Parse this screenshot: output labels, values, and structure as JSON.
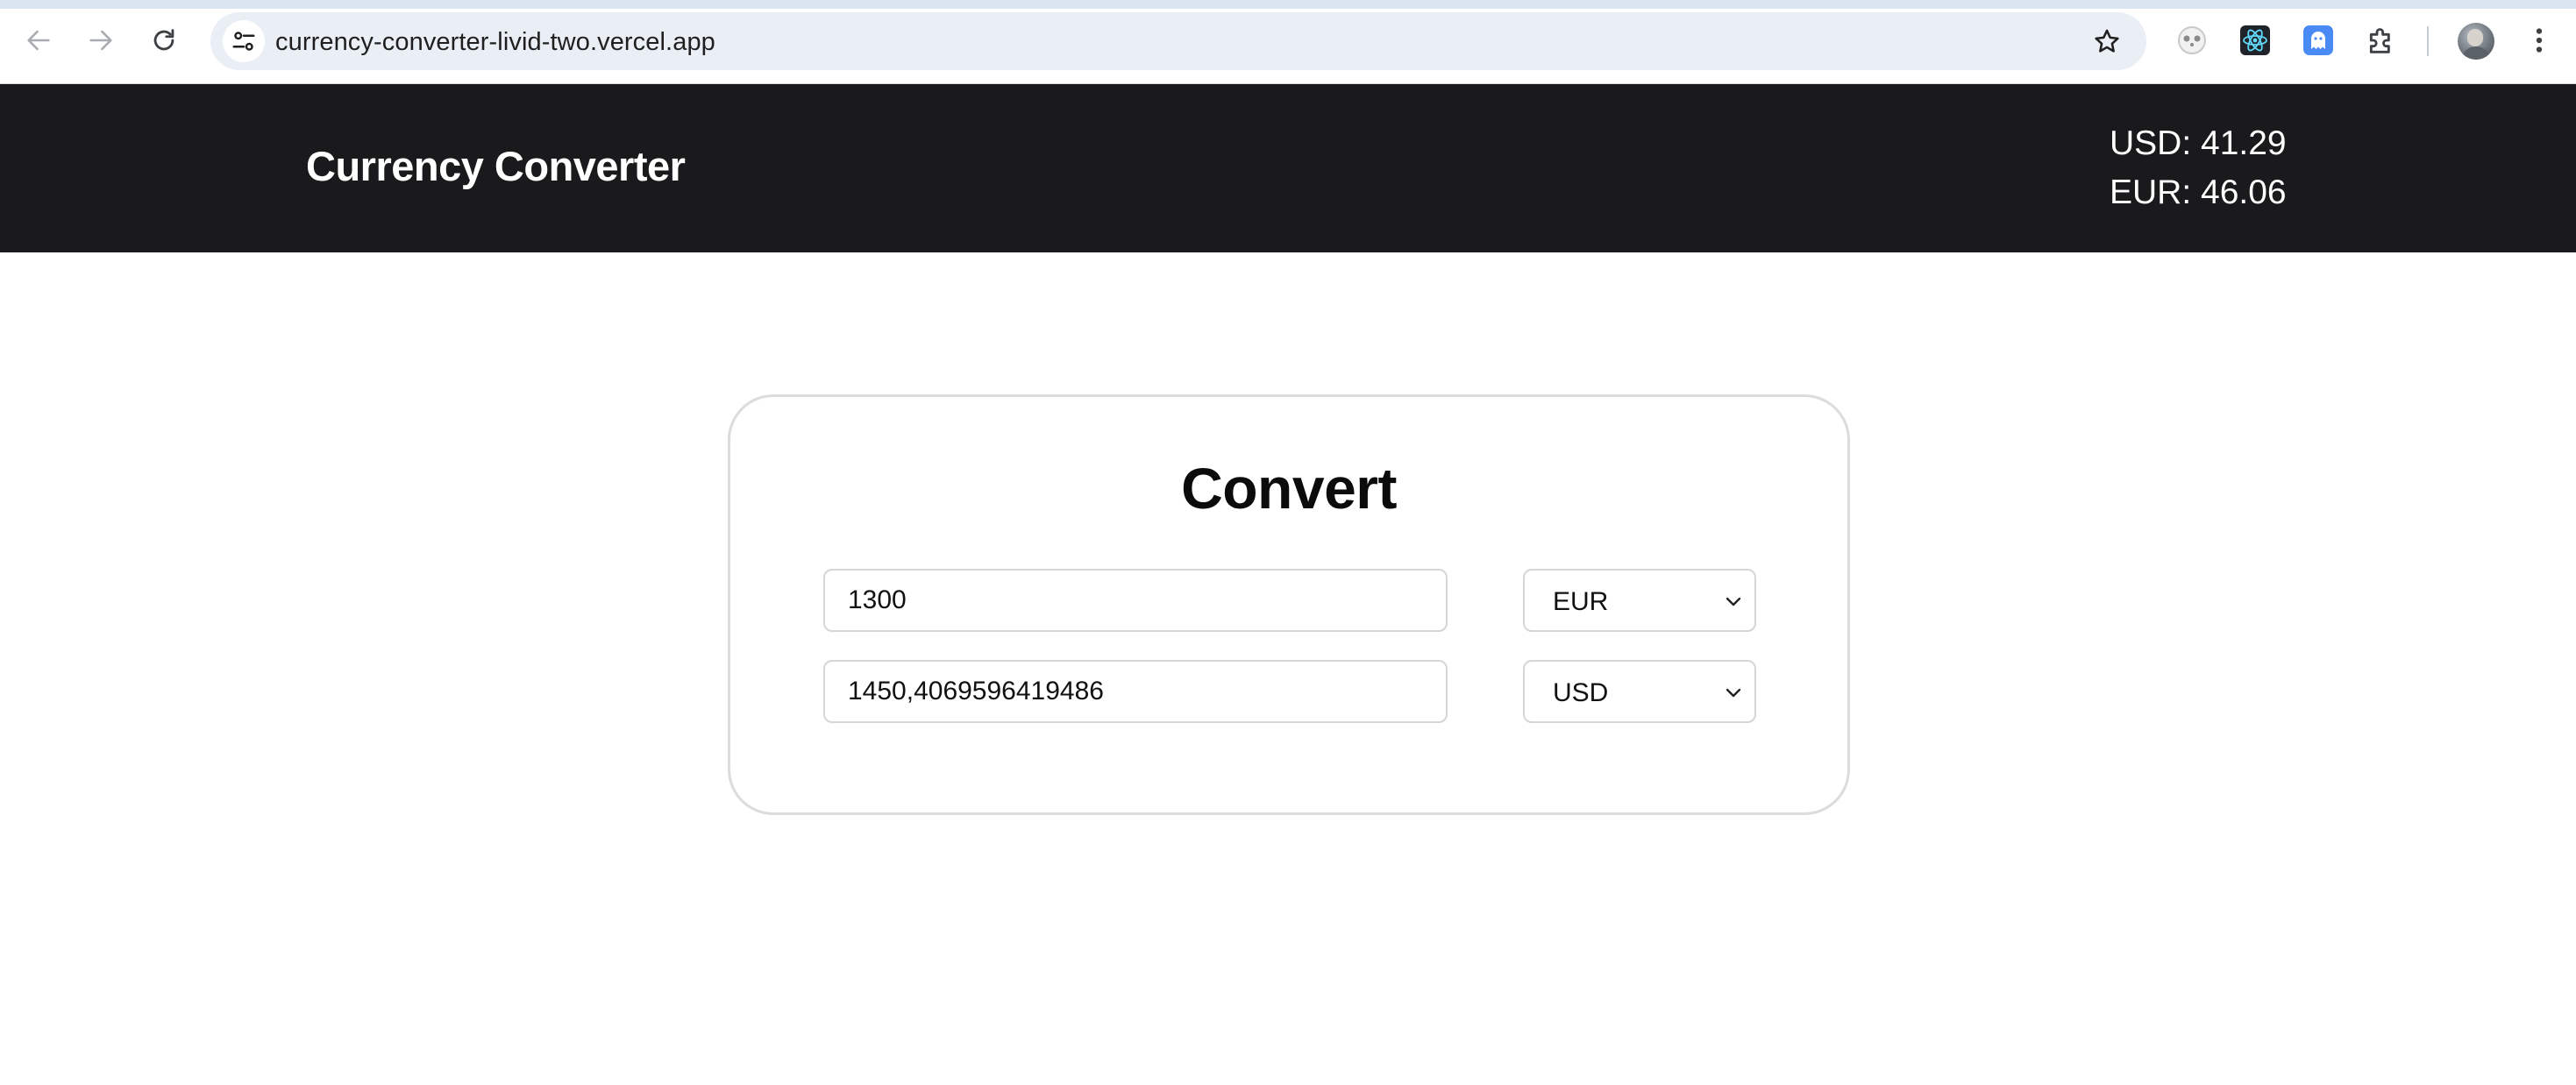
{
  "browser": {
    "url": "currency-converter-livid-two.vercel.app",
    "nav": {
      "back_icon": "arrow-left-icon",
      "forward_icon": "arrow-right-icon",
      "reload_icon": "reload-icon"
    },
    "extensions": [
      "panda-extension-icon",
      "react-devtools-icon",
      "ghost-extension-icon",
      "puzzle-extensions-icon"
    ]
  },
  "header": {
    "title": "Currency Converter",
    "rates": {
      "usd": "USD: 41.29",
      "eur": "EUR: 46.06"
    }
  },
  "converter": {
    "title": "Convert",
    "from": {
      "amount": "1300",
      "currency": "EUR"
    },
    "to": {
      "amount": "1450,4069596419486",
      "currency": "USD"
    }
  },
  "colors": {
    "header_bg": "#1a1a1c",
    "card_border": "#dcdcdc",
    "omnibox_bg": "#eaeef5"
  }
}
